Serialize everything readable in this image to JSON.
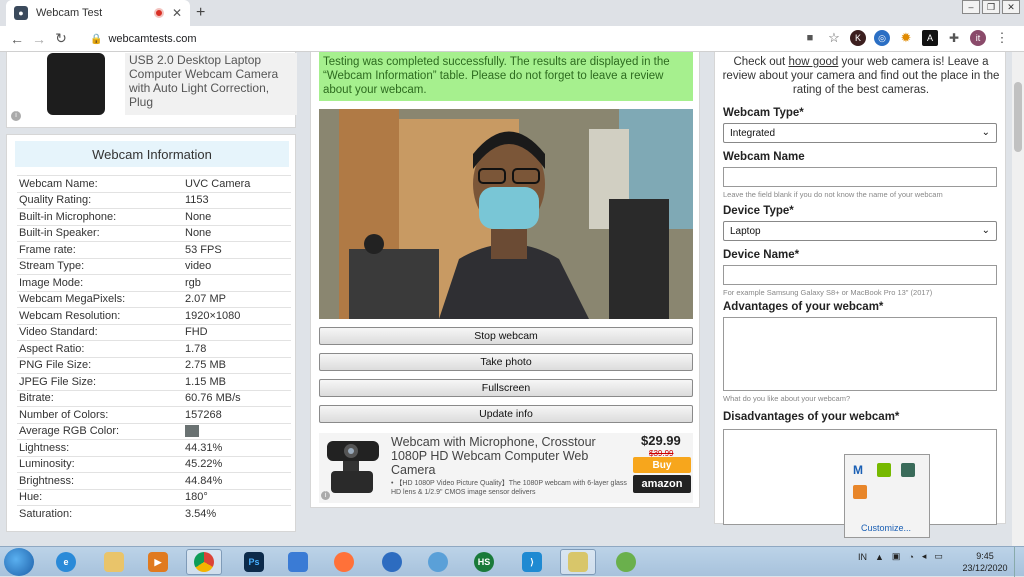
{
  "browser": {
    "tab_title": "Webcam Test",
    "url": "webcamtests.com",
    "profile_initial": "it"
  },
  "ad_top": {
    "text": "USB 2.0 Desktop Laptop Computer Webcam Camera with Auto Light Correction, Plug"
  },
  "webcam_info": {
    "title": "Webcam Information",
    "rows": [
      {
        "key": "Webcam Name:",
        "value": "UVC Camera"
      },
      {
        "key": "Quality Rating:",
        "value": "1153"
      },
      {
        "key": "Built-in Microphone:",
        "value": "None"
      },
      {
        "key": "Built-in Speaker:",
        "value": "None"
      },
      {
        "key": "Frame rate:",
        "value": "53 FPS"
      },
      {
        "key": "Stream Type:",
        "value": "video"
      },
      {
        "key": "Image Mode:",
        "value": "rgb"
      },
      {
        "key": "Webcam MegaPixels:",
        "value": "2.07 MP"
      },
      {
        "key": "Webcam Resolution:",
        "value": "1920×1080"
      },
      {
        "key": "Video Standard:",
        "value": "FHD"
      },
      {
        "key": "Aspect Ratio:",
        "value": "1.78"
      },
      {
        "key": "PNG File Size:",
        "value": "2.75 MB"
      },
      {
        "key": "JPEG File Size:",
        "value": "1.15 MB"
      },
      {
        "key": "Bitrate:",
        "value": "60.76 MB/s"
      },
      {
        "key": "Number of Colors:",
        "value": "157268"
      },
      {
        "key": "Average RGB Color:",
        "value": ""
      },
      {
        "key": "Lightness:",
        "value": "44.31%"
      },
      {
        "key": "Luminosity:",
        "value": "45.22%"
      },
      {
        "key": "Brightness:",
        "value": "44.84%"
      },
      {
        "key": "Hue:",
        "value": "180°"
      },
      {
        "key": "Saturation:",
        "value": "3.54%"
      }
    ],
    "average_rgb_color": "#6a7272"
  },
  "center": {
    "success_message": "Testing was completed successfully. The results are displayed in the “Webcam Information” table. Please do not forget to leave a review about your webcam.",
    "buttons": {
      "stop": "Stop webcam",
      "photo": "Take photo",
      "fullscreen": "Fullscreen",
      "update": "Update info"
    },
    "product": {
      "title": "Webcam with Microphone, Crosstour 1080P HD Webcam Computer Web Camera",
      "bullet": "• 【HD 1080P Video Picture Quality】The 1080P webcam with 6-layer glass HD lens & 1/2.9\" CMOS image sensor delivers",
      "price": "$29.99",
      "old_price": "$39.99",
      "buy_label": "Buy",
      "store_label": "amazon"
    }
  },
  "form": {
    "intro_before": "Check out ",
    "intro_link": "how good",
    "intro_after": " your web camera is! Leave a review about your camera and find out the place in the rating of the best cameras.",
    "webcam_type_label": "Webcam Type*",
    "webcam_type_value": "Integrated",
    "webcam_name_label": "Webcam Name",
    "webcam_name_help": "Leave the field blank if you do not know the name of your webcam",
    "device_type_label": "Device Type*",
    "device_type_value": "Laptop",
    "device_name_label": "Device Name*",
    "device_name_help": "For example Samsung Galaxy S8+ or MacBook Pro 13\" (2017)",
    "advantages_label": "Advantages of your webcam*",
    "advantages_help": "What do you like about your webcam?",
    "disadvantages_label": "Disadvantages of your webcam*"
  },
  "tray": {
    "customize": "Customize...",
    "lang": "IN",
    "time": "9:45",
    "date": "23/12/2020"
  }
}
